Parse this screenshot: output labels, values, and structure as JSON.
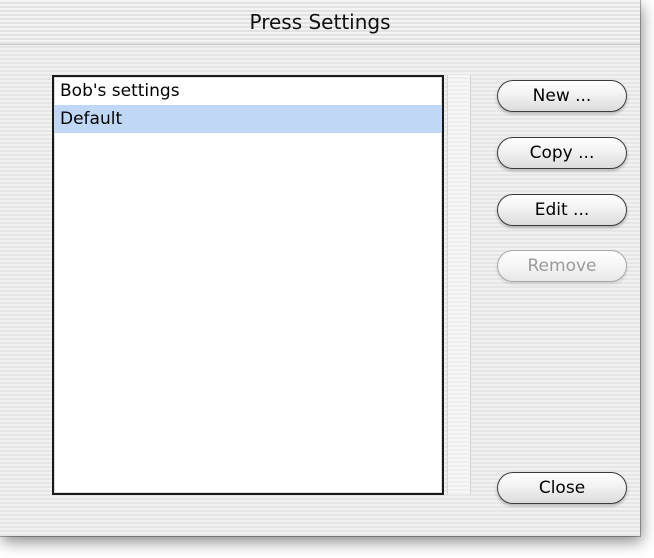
{
  "window": {
    "title": "Press Settings"
  },
  "list": {
    "items": [
      {
        "label": "Bob's settings",
        "selected": false
      },
      {
        "label": "Default",
        "selected": true
      }
    ]
  },
  "buttons": {
    "new_label": "New ...",
    "copy_label": "Copy ...",
    "edit_label": "Edit ...",
    "remove_label": "Remove",
    "close_label": "Close"
  },
  "colors": {
    "selection": "#c0d7f5",
    "disabled_text": "#9a9a9a"
  }
}
